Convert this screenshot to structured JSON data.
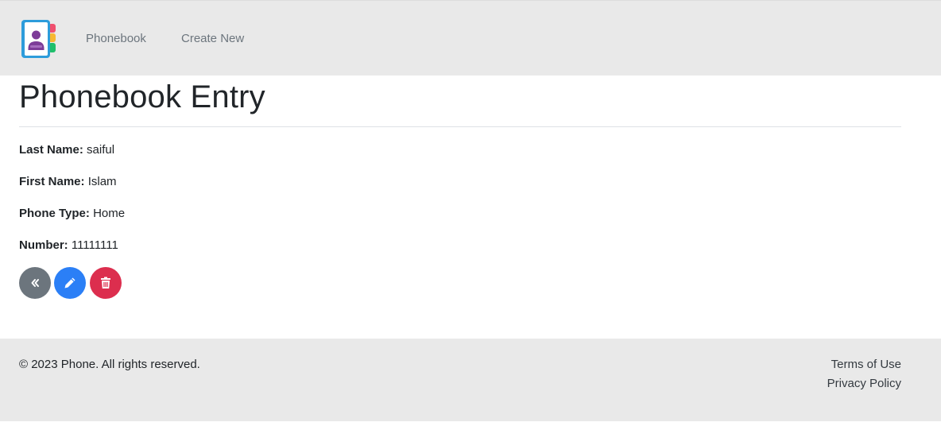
{
  "nav": {
    "logo_icon": "phonebook-contact-icon",
    "links": [
      {
        "label": "Phonebook"
      },
      {
        "label": "Create New"
      }
    ]
  },
  "main": {
    "title": "Phonebook Entry",
    "fields": [
      {
        "label": "Last Name:",
        "value": "saiful"
      },
      {
        "label": "First Name:",
        "value": "Islam"
      },
      {
        "label": "Phone Type:",
        "value": "Home"
      },
      {
        "label": "Number:",
        "value": "11111111"
      }
    ],
    "actions": [
      {
        "icon": "double-chevron-left-icon",
        "color": "#6c757d"
      },
      {
        "icon": "pencil-icon",
        "color": "#2b7ff6"
      },
      {
        "icon": "trash-icon",
        "color": "#dc2e4e"
      }
    ]
  },
  "footer": {
    "copyright": "© 2023 Phone. All rights reserved.",
    "links": [
      {
        "label": "Terms of Use"
      },
      {
        "label": "Privacy Policy"
      }
    ]
  }
}
